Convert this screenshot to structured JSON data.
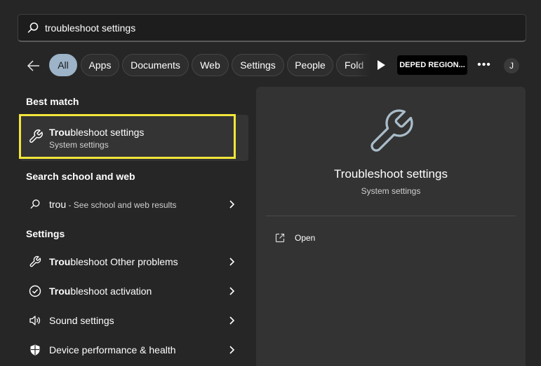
{
  "search": {
    "query": "troubleshoot settings",
    "icon": "search-icon"
  },
  "filters": {
    "back_icon": "back-arrow-icon",
    "chips": [
      "All",
      "Apps",
      "Documents",
      "Web",
      "Settings",
      "People",
      "Fold"
    ],
    "active": "All",
    "play_icon": "play-icon",
    "org_badge": "DEPED REGION...",
    "more_label": "•••",
    "avatar_initial": "J"
  },
  "best_match": {
    "heading": "Best match",
    "title_bold": "Trou",
    "title_rest": "bleshoot settings",
    "subtitle": "System settings",
    "icon": "wrench-icon",
    "highlight_color": "#f2e53a"
  },
  "school_web": {
    "heading": "Search school and web",
    "query": "trou",
    "hint": " - See school and web results",
    "icon": "search-icon"
  },
  "settings": {
    "heading": "Settings",
    "items": [
      {
        "bold": "Trou",
        "rest": "bleshoot Other problems",
        "icon": "wrench-icon"
      },
      {
        "bold": "Trou",
        "rest": "bleshoot activation",
        "icon": "check-circle-icon"
      },
      {
        "bold": "",
        "rest": "Sound settings",
        "icon": "speaker-icon"
      },
      {
        "bold": "",
        "rest": "Device performance & health",
        "icon": "shield-icon"
      }
    ]
  },
  "details": {
    "title": "Troubleshoot settings",
    "subtitle": "System settings",
    "icon": "wrench-icon",
    "actions": [
      {
        "label": "Open",
        "icon": "open-external-icon"
      }
    ]
  },
  "colors": {
    "background": "#262626",
    "panel": "#333333",
    "accent_chip": "#9cb3c8",
    "icon_accent": "#a9bcc9"
  }
}
